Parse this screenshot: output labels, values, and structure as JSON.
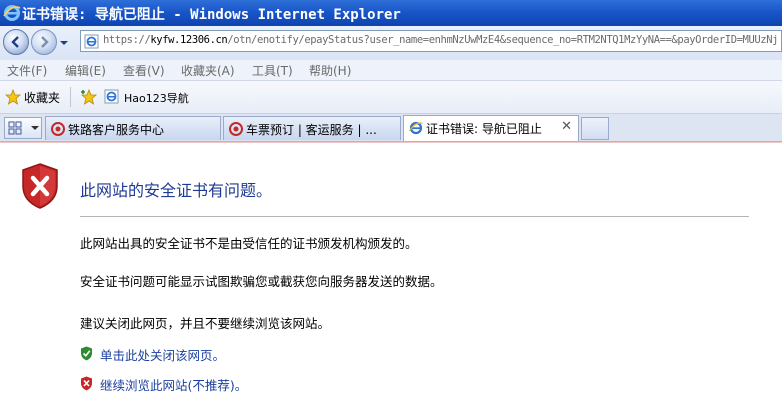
{
  "window": {
    "title": "证书错误: 导航已阻止 - Windows Internet Explorer"
  },
  "address_bar": {
    "url_prefix": "https://",
    "url_host": "kyfw.12306.cn",
    "url_rest": "/otn/enotify/epayStatus?user_name=enhmNzUwMzE4&sequence_no=RTM2NTQ1MzYyNA==&payOrderID=MUUzNj"
  },
  "menu": {
    "items": [
      "文件(F)",
      "编辑(E)",
      "查看(V)",
      "收藏夹(A)",
      "工具(T)",
      "帮助(H)"
    ]
  },
  "favorites_bar": {
    "favorites_label": "收藏夹",
    "link_label": "Hao123导航"
  },
  "tabs": [
    {
      "label": "铁路客户服务中心",
      "icon": "12306-logo-icon"
    },
    {
      "label": "车票预订 | 客运服务 | ...",
      "icon": "12306-logo-icon"
    },
    {
      "label": "证书错误: 导航已阻止",
      "icon": "ie-page-icon",
      "active": true
    }
  ],
  "error_page": {
    "heading": "此网站的安全证书有问题。",
    "paragraphs": [
      "此网站出具的安全证书不是由受信任的证书颁发机构颁发的。",
      "安全证书问题可能显示试图欺骗您或截获您向服务器发送的数据。",
      "建议关闭此网页，并且不要继续浏览该网站。"
    ],
    "close_link": "单击此处关闭该网页。",
    "continue_link": "继续浏览此网站(不推荐)。"
  },
  "colors": {
    "title_bar": "#1a56c9",
    "heading": "#1f3a93",
    "link": "#1a3f9e",
    "error_shield": "#c62828",
    "safe_shield": "#2e8b2e"
  }
}
